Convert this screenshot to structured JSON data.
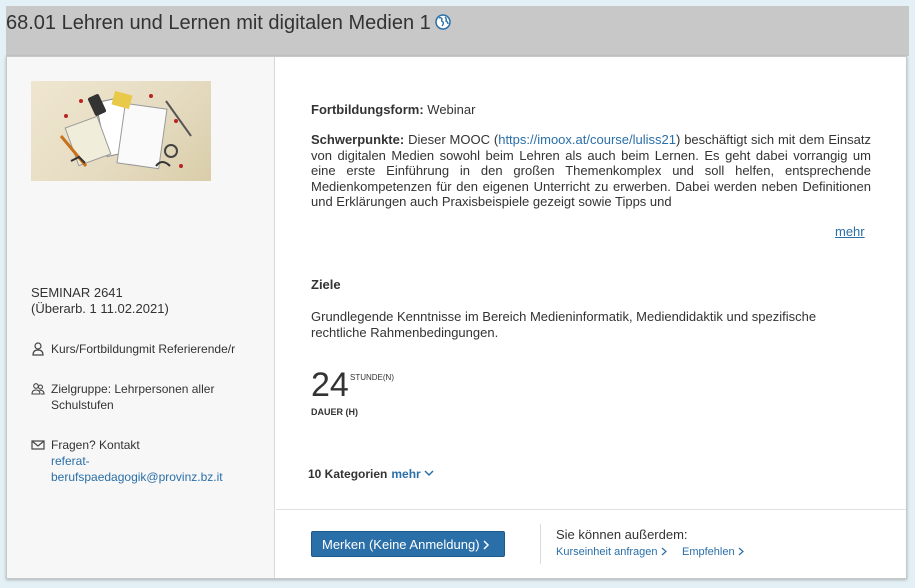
{
  "header": {
    "title": "68.01 Lehren und Lernen mit digitalen Medien 1",
    "globe_icon": "globe-icon"
  },
  "sidebar": {
    "seminar_line1": "SEMINAR 2641",
    "seminar_line2": "(Überarb. 1 11.02.2021)",
    "course_type": "Kurs/Fortbildungmit Referierende/r",
    "target_group": "Zielgruppe: Lehrpersonen aller Schulstufen",
    "contact_label": "Fragen? Kontakt",
    "contact_email_part1": "referat-",
    "contact_email_part2": "berufspaedagogik@provinz.bz.it",
    "icons": [
      "person-icon",
      "group-icon",
      "envelope-icon"
    ]
  },
  "main": {
    "form_label": "Fortbildungsform:",
    "form_value": "Webinar",
    "focus_label": "Schwerpunkte:",
    "focus_text_before": "Dieser MOOC (",
    "focus_link": "https://imoox.at/course/luliss21",
    "focus_text_after": ") beschäftigt sich mit dem Einsatz von digitalen Medien sowohl beim Lehren als auch beim Lernen. Es geht dabei vorrangig um eine erste Einführung in den großen Themenkomplex und soll helfen, entsprechende Medienkompetenzen für den eigenen Unterricht zu erwerben. Dabei werden neben Definitionen und Erklärungen auch Praxisbeispiele gezeigt sowie Tipps und",
    "more_label": "mehr",
    "goals_heading": "Ziele",
    "goals_text": "Grundlegende Kenntnisse im Bereich Medieninformatik, Mediendidaktik und spezifische rechtliche Rahmenbedingungen.",
    "duration_value": "24",
    "duration_unit": "STUNDE(N)",
    "duration_label": "DAUER (H)",
    "categories_label": "10 Kategorien",
    "categories_more": "mehr"
  },
  "footer": {
    "bookmark_button": "Merken (Keine Anmeldung)",
    "also_text": "Sie können außerdem:",
    "request_link": "Kurseinheit anfragen",
    "recommend_link": "Empfehlen"
  },
  "colors": {
    "accent": "#2a6fa8",
    "header_bg": "#c8c8c8",
    "page_bg": "#e3f0f5"
  }
}
